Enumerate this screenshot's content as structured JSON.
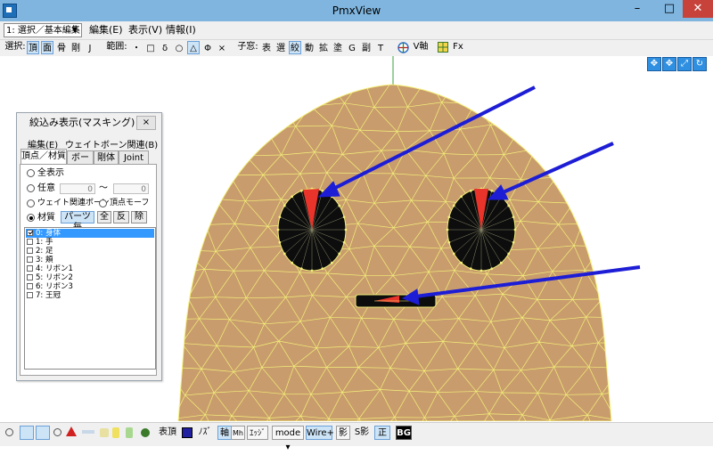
{
  "window": {
    "title": "PmxView",
    "minimize": "–",
    "maximize": "□",
    "close": "✕"
  },
  "menubar": {
    "mode_value": "1: 選択／基本編集",
    "items": [
      "編集(E)",
      "表示(V)",
      "情報(I)"
    ]
  },
  "toolbar": {
    "select_label": "選択:",
    "select_buttons": [
      "頂",
      "面",
      "骨",
      "剛",
      "J"
    ],
    "range_label": "範囲:",
    "range_buttons": [
      "・",
      "□",
      "δ",
      "○",
      "△",
      "Φ",
      "×"
    ],
    "child_label": "子窓:",
    "child_buttons": [
      "表",
      "選",
      "絞",
      "動",
      "拡",
      "塗",
      "G",
      "副",
      "T"
    ],
    "v_axis_label": "V軸",
    "fx_label": "Fx"
  },
  "panel": {
    "title": "絞込み表示(マスキング)",
    "close": "×",
    "menu": [
      "編集(E)",
      "ウェイトボーン関連(B)"
    ],
    "tabs": [
      "頂点／材質",
      "ボーン",
      "剛体",
      "Joint"
    ],
    "options": {
      "show_all": "全表示",
      "arbitrary": "任意",
      "range_from": "0",
      "tilde": "〜",
      "range_to": "0",
      "weight_bone": "ウェイト関連ボーン",
      "vertex_morph": "頂点モーフ",
      "material": "材質",
      "per_part": "パーツ毎",
      "all": "全",
      "invert": "反",
      "exclude": "除"
    },
    "materials": [
      "0: 身体",
      "1: 手",
      "2: 足",
      "3: 頬",
      "4: リボン1",
      "5: リボン2",
      "6: リボン3",
      "7: 王冠"
    ],
    "checked_index": 0
  },
  "bottombar": {
    "face_label": "表頂",
    "no_label": "ﾉｽﾞ",
    "axis": "軸",
    "mh": "Mh",
    "edge": "ｴｯｼﾞ",
    "mode": "mode",
    "wire": "Wire+",
    "shadow": "影",
    "sshadow": "S影",
    "ortho": "正",
    "bg": "BG"
  },
  "colors": {
    "skin": "#c89c6c",
    "wire": "#f4f07a",
    "arrow": "#1d1dd6",
    "highlight": "#e8342a",
    "titlebar": "#7fb5df"
  }
}
